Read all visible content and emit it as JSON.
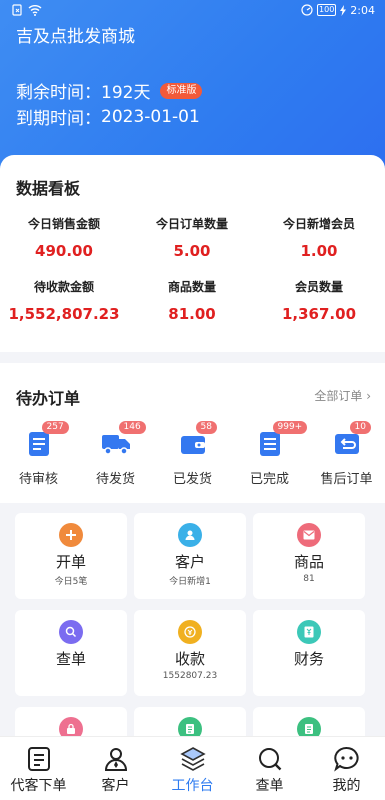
{
  "status_bar": {
    "time": "2:04",
    "battery": "100"
  },
  "header": {
    "title": "吉及点批发商城",
    "remaining_label": "剩余时间：",
    "remaining_value": "192天",
    "edition_badge": "标准版",
    "expire_label": "到期时间：",
    "expire_value": "2023-01-01"
  },
  "dashboard": {
    "title": "数据看板",
    "stats": [
      {
        "label": "今日销售金额",
        "value": "490.00"
      },
      {
        "label": "今日订单数量",
        "value": "5.00"
      },
      {
        "label": "今日新增会员",
        "value": "1.00"
      },
      {
        "label": "待收款金额",
        "value": "1,552,807.23"
      },
      {
        "label": "商品数量",
        "value": "81.00"
      },
      {
        "label": "会员数量",
        "value": "1,367.00"
      }
    ]
  },
  "pending_orders": {
    "title": "待办订单",
    "all_link": "全部订单",
    "items": [
      {
        "label": "待审核",
        "count": "257",
        "icon": "document-icon"
      },
      {
        "label": "待发货",
        "count": "146",
        "icon": "truck-icon"
      },
      {
        "label": "已发货",
        "count": "58",
        "icon": "wallet-icon"
      },
      {
        "label": "已完成",
        "count": "999+",
        "icon": "checklist-icon"
      },
      {
        "label": "售后订单",
        "count": "10",
        "icon": "return-icon"
      }
    ]
  },
  "quick_actions": [
    {
      "title": "开单",
      "sub": "今日5笔",
      "icon": "plus-icon",
      "color": "#f08a3c"
    },
    {
      "title": "客户",
      "sub": "今日新增1",
      "icon": "person-icon",
      "color": "#3ab0e8"
    },
    {
      "title": "商品",
      "sub": "81",
      "icon": "mail-icon",
      "color": "#ee6b7a"
    },
    {
      "title": "查单",
      "sub": "",
      "icon": "search-icon",
      "color": "#7b6cf0"
    },
    {
      "title": "收款",
      "sub": "1552807.23",
      "icon": "coin-icon",
      "color": "#f0b020"
    },
    {
      "title": "财务",
      "sub": "",
      "icon": "finance-icon",
      "color": "#3cc8b8"
    },
    {
      "title": "",
      "sub": "",
      "icon": "lock-icon",
      "color": "#ee7090"
    },
    {
      "title": "",
      "sub": "",
      "icon": "clipboard-icon",
      "color": "#3cc080"
    },
    {
      "title": "",
      "sub": "",
      "icon": "clipboard-icon",
      "color": "#3cc080"
    }
  ],
  "tabbar": {
    "tabs": [
      {
        "label": "代客下单",
        "icon": "order-icon"
      },
      {
        "label": "客户",
        "icon": "user-icon"
      },
      {
        "label": "工作台",
        "icon": "layers-icon",
        "active": true
      },
      {
        "label": "查单",
        "icon": "search-icon"
      },
      {
        "label": "我的",
        "icon": "chat-face-icon"
      }
    ]
  },
  "colors": {
    "primary": "#2f7cf0",
    "value_red": "#e02020",
    "badge_red": "#f25a3a"
  }
}
